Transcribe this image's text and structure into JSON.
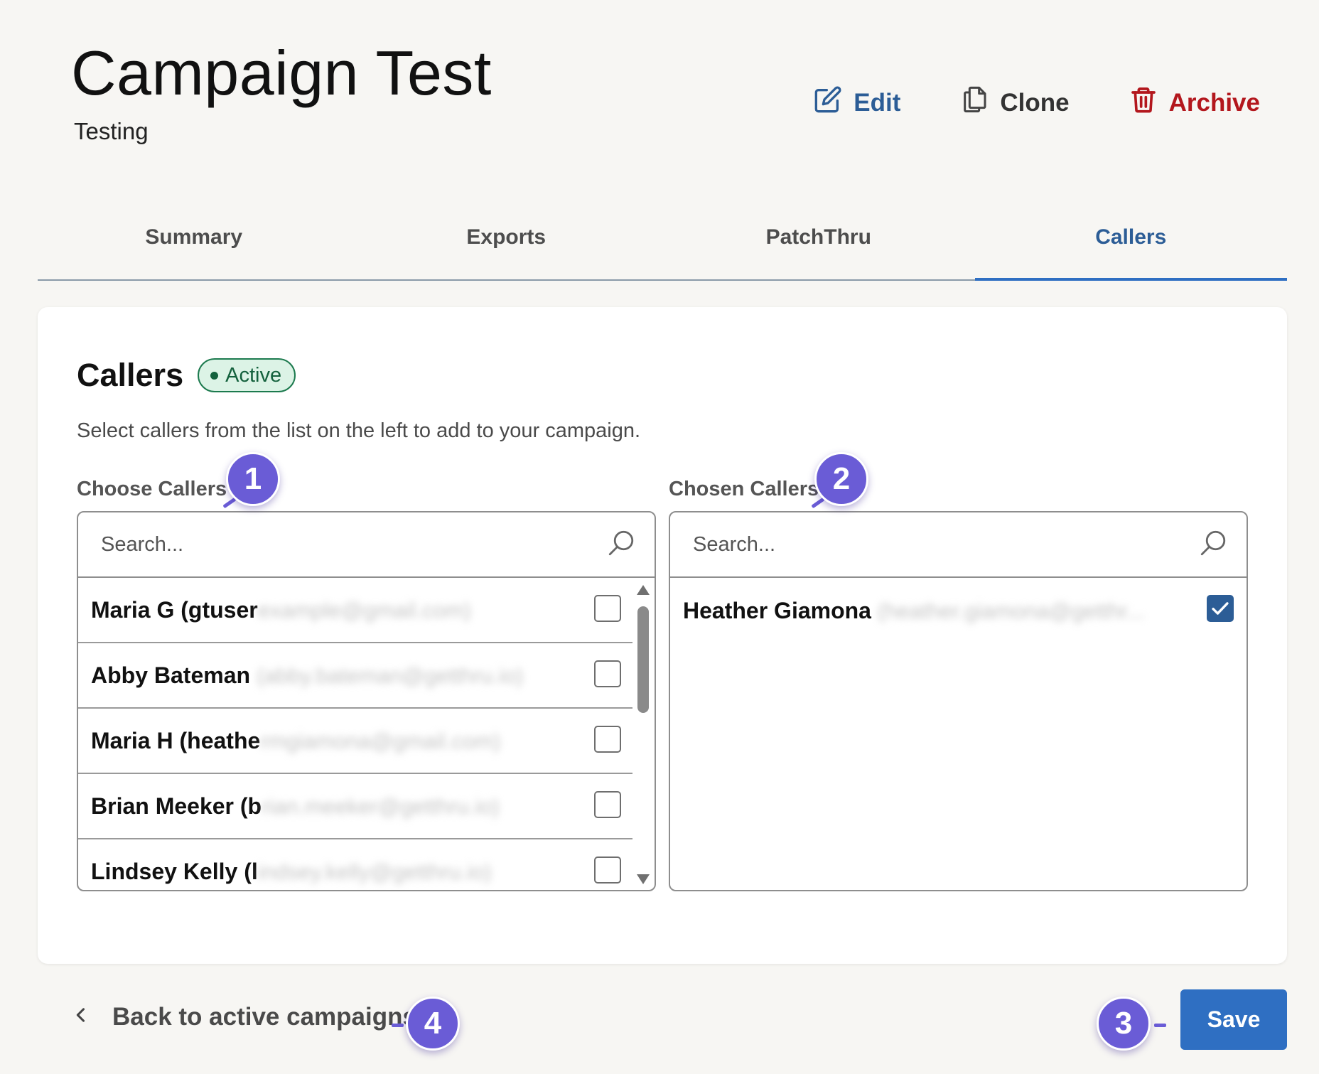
{
  "header": {
    "title": "Campaign Test",
    "subtitle": "Testing",
    "actions": {
      "edit": "Edit",
      "clone": "Clone",
      "archive": "Archive"
    }
  },
  "tabs": [
    {
      "label": "Summary",
      "active": false
    },
    {
      "label": "Exports",
      "active": false
    },
    {
      "label": "PatchThru",
      "active": false
    },
    {
      "label": "Callers",
      "active": true
    }
  ],
  "callers_card": {
    "title": "Callers",
    "status_badge": "Active",
    "description": "Select callers from the list on the left to add to your campaign.",
    "choose_panel": {
      "label": "Choose Callers",
      "search_placeholder": "Search...",
      "rows": [
        {
          "visible": "Maria G (gtuser",
          "obscured": "example@gmail.com)",
          "checked": false
        },
        {
          "visible": "Abby Bateman ",
          "obscured": "(abby.bateman@getthru.io)",
          "checked": false
        },
        {
          "visible": "Maria H (heathe",
          "obscured": "rmgiamona@gmail.com)",
          "checked": false
        },
        {
          "visible": "Brian Meeker (b",
          "obscured": "rian.meeker@getthru.io)",
          "checked": false
        },
        {
          "visible": "Lindsey Kelly (l",
          "obscured": "indsey.kelly@getthru.io)",
          "checked": false
        }
      ]
    },
    "chosen_panel": {
      "label": "Chosen Callers",
      "search_placeholder": "Search...",
      "rows": [
        {
          "visible": "Heather Giamona ",
          "obscured": "(heather.giamona@getthr...",
          "checked": true
        }
      ]
    }
  },
  "footer": {
    "back_label": "Back to active campaigns",
    "save_label": "Save"
  },
  "markers": [
    "1",
    "2",
    "3",
    "4"
  ],
  "colors": {
    "accent": "#2f6fc2",
    "link_blue": "#2c5d96",
    "danger": "#b3171d",
    "active_badge_bg": "#dcf3e6",
    "marker": "#6a5cd6"
  },
  "icons": {
    "edit": "pencil-square-icon",
    "clone": "copy-icon",
    "archive": "trash-icon",
    "search": "magnifier-icon",
    "back": "chevron-left-icon",
    "check": "checkmark-icon"
  }
}
